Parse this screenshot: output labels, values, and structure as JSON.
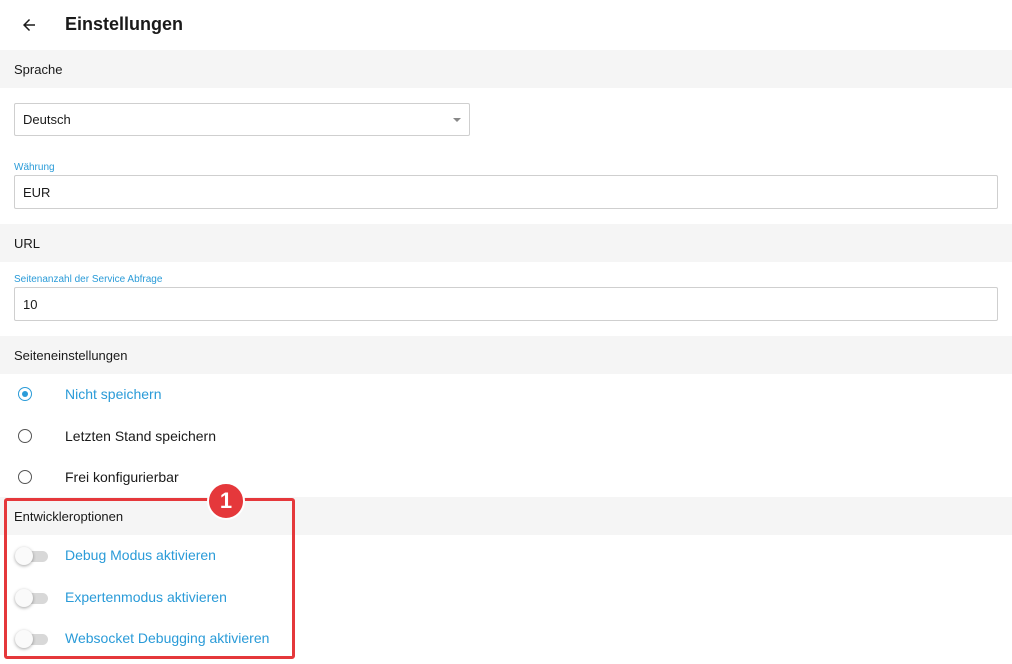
{
  "appbar": {
    "title": "Einstellungen",
    "back_icon": "arrow-left-icon"
  },
  "sections": {
    "language_header": "Sprache",
    "url_header": "URL",
    "page_settings_header": "Seiteneinstellungen",
    "developer_header": "Entwickleroptionen"
  },
  "language": {
    "selected": "Deutsch"
  },
  "currency": {
    "label": "Währung",
    "value": "EUR"
  },
  "service_pages": {
    "label": "Seitenanzahl der Service Abfrage",
    "value": "10"
  },
  "page_settings": {
    "options": [
      {
        "label": "Nicht speichern",
        "checked": true
      },
      {
        "label": "Letzten Stand speichern",
        "checked": false
      },
      {
        "label": "Frei konfigurierbar",
        "checked": false
      }
    ]
  },
  "developer": {
    "toggles": [
      {
        "label": "Debug Modus aktivieren",
        "on": false
      },
      {
        "label": "Expertenmodus aktivieren",
        "on": false
      },
      {
        "label": "Websocket Debugging aktivieren",
        "on": false
      }
    ]
  },
  "annotation": {
    "badge": "1"
  },
  "colors": {
    "accent": "#2a9bd8",
    "annotation": "#e5383b",
    "section_bg": "#f5f5f5"
  }
}
